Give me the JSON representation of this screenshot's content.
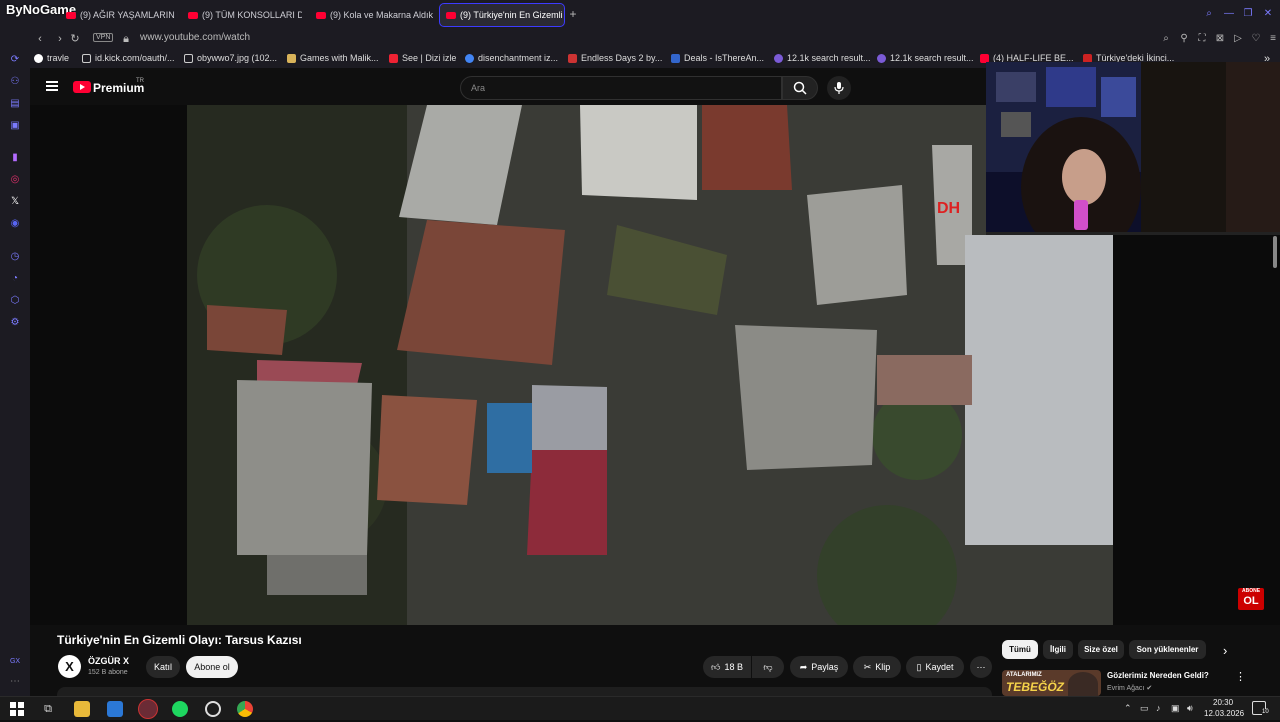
{
  "browser": {
    "brand": "ByNoGame",
    "tabs": [
      {
        "label": "(9) AĞIR YAŞAMLARIN EN"
      },
      {
        "label": "(9) TÜM KONSOLLARI DE"
      },
      {
        "label": "(9) Kola ve Makarna Aldık"
      },
      {
        "label": "(9) Türkiye'nin En Gizemli"
      }
    ],
    "url": "www.youtube.com/watch",
    "vpn": "VPN",
    "bookmarks": [
      {
        "label": "travle"
      },
      {
        "label": "id.kick.com/oauth/..."
      },
      {
        "label": "obywwo7.jpg (102..."
      },
      {
        "label": "Games with Malik..."
      },
      {
        "label": "See | Dizi izle"
      },
      {
        "label": "disenchantment iz..."
      },
      {
        "label": "Endless Days 2 by..."
      },
      {
        "label": "Deals - IsThereAn..."
      },
      {
        "label": "12.1k search result..."
      },
      {
        "label": "12.1k search result..."
      },
      {
        "label": "(4) HALF-LIFE BE..."
      },
      {
        "label": "Türkiye'deki İkinci..."
      }
    ]
  },
  "youtube": {
    "brand": "Premium",
    "region": "TR",
    "search_placeholder": "Ara"
  },
  "video": {
    "overlay_text": "DH",
    "badge_top": "ABONE",
    "badge_bottom": "OL",
    "title": "Türkiye'nin En Gizemli Olayı: Tarsus Kazısı",
    "channel": {
      "avatar_letter": "X",
      "name": "ÖZGÜR X",
      "subscribers": "152 B abone"
    },
    "join_label": "Katıl",
    "subscribe_label": "Abone ol",
    "likes": "18 B",
    "share_label": "Paylaş",
    "clip_label": "Klip",
    "save_label": "Kaydet"
  },
  "recommendations": {
    "chips": [
      {
        "label": "Tümü"
      },
      {
        "label": "İlgili"
      },
      {
        "label": "Size özel"
      },
      {
        "label": "Son yüklenenler"
      }
    ],
    "first": {
      "thumb_text": "ATALARIMIZ",
      "thumb_text2": "TEBEĞÖZ",
      "title": "Gözlerimiz Nereden Geldi?",
      "channel": "Evrim Ağacı"
    }
  },
  "taskbar": {
    "time": "20:30",
    "date": "12.03.2026",
    "notifications": "10"
  },
  "sidebar_label": "GX"
}
